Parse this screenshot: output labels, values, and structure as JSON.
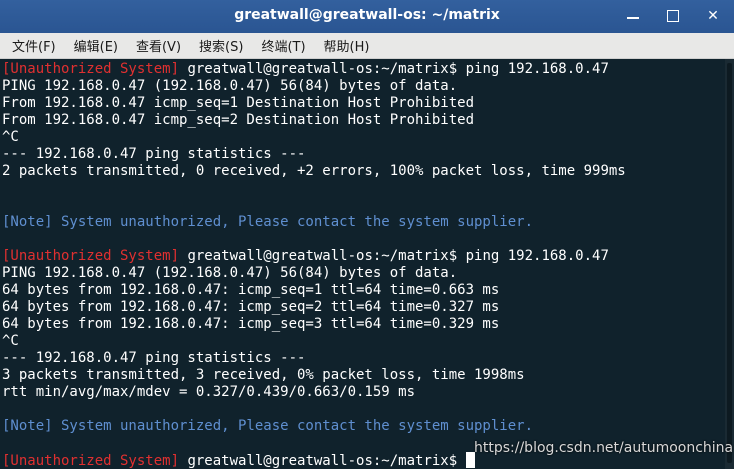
{
  "window": {
    "title": "greatwall@greatwall-os: ~/matrix",
    "controls": {
      "minimize_icon": "minimize-icon",
      "maximize_icon": "maximize-icon",
      "close_icon": "close-icon",
      "close_glyph": "✕"
    }
  },
  "menu": [
    {
      "label": "文件(F)"
    },
    {
      "label": "编辑(E)"
    },
    {
      "label": "查看(V)"
    },
    {
      "label": "搜索(S)"
    },
    {
      "label": "终端(T)"
    },
    {
      "label": "帮助(H)"
    }
  ],
  "terminal": {
    "lines": [
      {
        "prefix": "[Unauthorized System]",
        "text": " greatwall@greatwall-os:~/matrix$ ping 192.168.0.47"
      },
      {
        "text": "PING 192.168.0.47 (192.168.0.47) 56(84) bytes of data."
      },
      {
        "text": "From 192.168.0.47 icmp_seq=1 Destination Host Prohibited"
      },
      {
        "text": "From 192.168.0.47 icmp_seq=2 Destination Host Prohibited"
      },
      {
        "text": "^C"
      },
      {
        "text": "--- 192.168.0.47 ping statistics ---"
      },
      {
        "text": "2 packets transmitted, 0 received, +2 errors, 100% packet loss, time 999ms"
      },
      {
        "text": ""
      },
      {
        "text": ""
      },
      {
        "note": "[Note] System unauthorized, Please contact the system supplier."
      },
      {
        "text": ""
      },
      {
        "prefix": "[Unauthorized System]",
        "text": " greatwall@greatwall-os:~/matrix$ ping 192.168.0.47"
      },
      {
        "text": "PING 192.168.0.47 (192.168.0.47) 56(84) bytes of data."
      },
      {
        "text": "64 bytes from 192.168.0.47: icmp_seq=1 ttl=64 time=0.663 ms"
      },
      {
        "text": "64 bytes from 192.168.0.47: icmp_seq=2 ttl=64 time=0.327 ms"
      },
      {
        "text": "64 bytes from 192.168.0.47: icmp_seq=3 ttl=64 time=0.329 ms"
      },
      {
        "text": "^C"
      },
      {
        "text": "--- 192.168.0.47 ping statistics ---"
      },
      {
        "text": "3 packets transmitted, 3 received, 0% packet loss, time 1998ms"
      },
      {
        "text": "rtt min/avg/max/mdev = 0.327/0.439/0.663/0.159 ms"
      },
      {
        "text": ""
      },
      {
        "note": "[Note] System unauthorized, Please contact the system supplier."
      },
      {
        "text": ""
      },
      {
        "prefix": "[Unauthorized System]",
        "text": " greatwall@greatwall-os:~/matrix$ ",
        "cursor": true
      }
    ]
  },
  "watermark": "https://blog.csdn.net/autumoonchina",
  "colors": {
    "titlebar": "#2f5c99",
    "terminal_bg": "#10222c",
    "prefix_red": "#e03030",
    "note_blue": "#5f8fd0"
  }
}
